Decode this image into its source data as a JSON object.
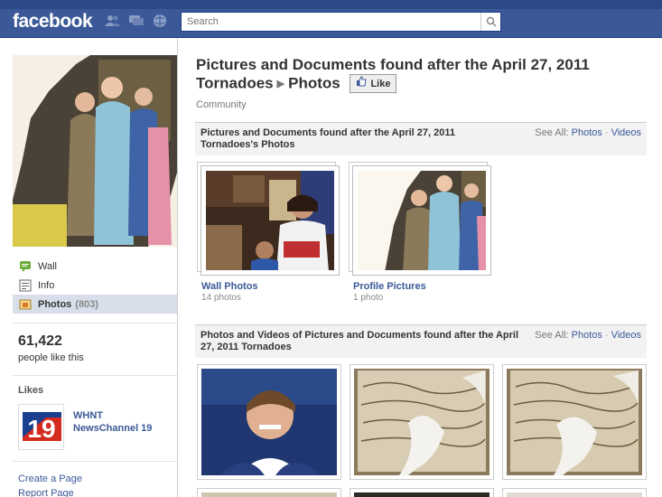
{
  "header": {
    "logo": "facebook",
    "search_placeholder": "Search",
    "icons": [
      "friends-icon",
      "messages-icon",
      "notifications-icon",
      "search-icon"
    ]
  },
  "sidebar": {
    "nav": [
      {
        "label": "Wall",
        "icon": "wall-icon"
      },
      {
        "label": "Info",
        "icon": "info-icon"
      },
      {
        "label": "Photos",
        "count": "(803)",
        "icon": "photos-icon"
      }
    ],
    "likes_count": "61,422",
    "likes_text": "people like this",
    "likes_heading": "Likes",
    "liked_page_line1": "WHNT",
    "liked_page_line2": "NewsChannel 19",
    "create_page": "Create a Page",
    "report_page": "Report Page"
  },
  "main": {
    "title_part1": "Pictures and Documents found after the April 27, 2011 Tornadoes",
    "title_part2": "Photos",
    "like_label": "Like",
    "subtitle": "Community",
    "section1": {
      "title": "Pictures and Documents found after the April 27, 2011 Tornadoes's Photos",
      "see_all": "See All:",
      "link_photos": "Photos",
      "link_videos": "Videos"
    },
    "albums": [
      {
        "name": "Wall Photos",
        "count": "14 photos"
      },
      {
        "name": "Profile Pictures",
        "count": "1 photo"
      }
    ],
    "section2": {
      "title": "Photos and Videos of Pictures and Documents found after the April 27, 2011 Tornadoes",
      "see_all": "See All:",
      "link_photos": "Photos",
      "link_videos": "Videos"
    }
  },
  "colors": {
    "brand": "#3b5998",
    "link": "#3b5998",
    "nav_active": "#d8dfea"
  }
}
